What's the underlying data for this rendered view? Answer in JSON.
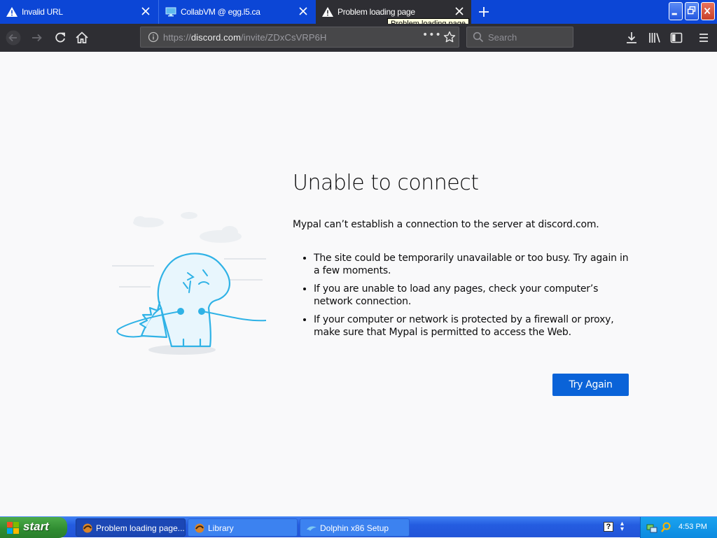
{
  "browser": {
    "tabs": [
      {
        "title": "Invalid URL",
        "icon": "warning-icon",
        "active": false
      },
      {
        "title": "CollabVM @ egg.l5.ca",
        "icon": "monitor-icon",
        "active": false
      },
      {
        "title": "Problem loading page",
        "icon": "warning-icon",
        "active": true
      }
    ],
    "tooltip": "Problem loading page",
    "url": {
      "prefix": "https://",
      "domain": "discord.com",
      "path": "/invite/ZDxCsVRP6H"
    },
    "search": {
      "placeholder": "Search"
    }
  },
  "page": {
    "title": "Unable to connect",
    "description": "Mypal can’t establish a connection to the server at discord.com.",
    "reasons": [
      "The site could be temporarily unavailable or too busy. Try again in a few moments.",
      "If you are unable to load any pages, check your computer’s network connection.",
      "If your computer or network is protected by a firewall or proxy, make sure that Mypal is permitted to access the Web."
    ],
    "try_again_label": "Try Again"
  },
  "taskbar": {
    "start_label": "start",
    "tasks": [
      {
        "label": "Problem loading page...",
        "icon": "mypal-icon",
        "active": true
      },
      {
        "label": "Library",
        "icon": "mypal-icon",
        "active": false
      },
      {
        "label": "Dolphin x86 Setup",
        "icon": "dolphin-icon",
        "active": false
      }
    ],
    "clock": "4:53 PM"
  },
  "colors": {
    "tabstrip": "#0c46d6",
    "toolbar": "#2e2e33",
    "page_bg": "#f9f9fa",
    "button": "#0a63d8",
    "taskbar": "#245ce0",
    "start": "#2f8c31"
  }
}
